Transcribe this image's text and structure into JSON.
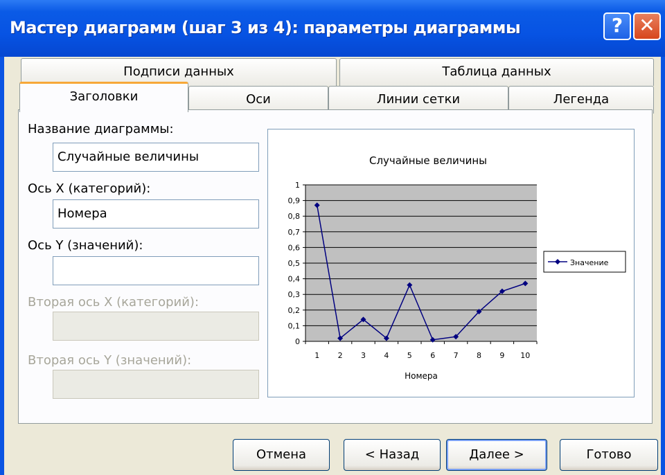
{
  "window": {
    "title": "Мастер диаграмм (шаг 3 из 4): параметры диаграммы",
    "help_label": "?",
    "close_label": "✕"
  },
  "tabs": {
    "row_back": [
      "Подписи данных",
      "Таблица данных"
    ],
    "row_front": [
      "Заголовки",
      "Оси",
      "Линии сетки",
      "Легенда"
    ],
    "active": "Заголовки"
  },
  "form": {
    "chart_title_label": "Название диаграммы:",
    "chart_title_value": "Случайные величины",
    "x_axis_label": "Ось X (категорий):",
    "x_axis_value": "Номера",
    "y_axis_label": "Ось Y (значений):",
    "y_axis_value": "",
    "x2_axis_label": "Вторая ось X (категорий):",
    "y2_axis_label": "Вторая ось Y (значений):"
  },
  "buttons": {
    "cancel": "Отмена",
    "back": "< Назад",
    "next": "Далее >",
    "finish": "Готово"
  },
  "colors": {
    "plot_area": "#C0C0C0",
    "series_line": "#000080",
    "titlebar": "#0A54E3",
    "tab_highlight": "#F7A839"
  },
  "chart_data": {
    "type": "line",
    "title": "Случайные величины",
    "xlabel": "Номера",
    "ylabel": "",
    "categories": [
      "1",
      "2",
      "3",
      "4",
      "5",
      "6",
      "7",
      "8",
      "9",
      "10"
    ],
    "series": [
      {
        "name": "Значение",
        "values": [
          0.87,
          0.02,
          0.14,
          0.02,
          0.36,
          0.01,
          0.03,
          0.19,
          0.32,
          0.37
        ]
      }
    ],
    "ylim": [
      0,
      1
    ],
    "yticks": [
      "0",
      "0,1",
      "0,2",
      "0,3",
      "0,4",
      "0,5",
      "0,6",
      "0,7",
      "0,8",
      "0,9",
      "1"
    ],
    "grid": true,
    "legend": "right"
  }
}
